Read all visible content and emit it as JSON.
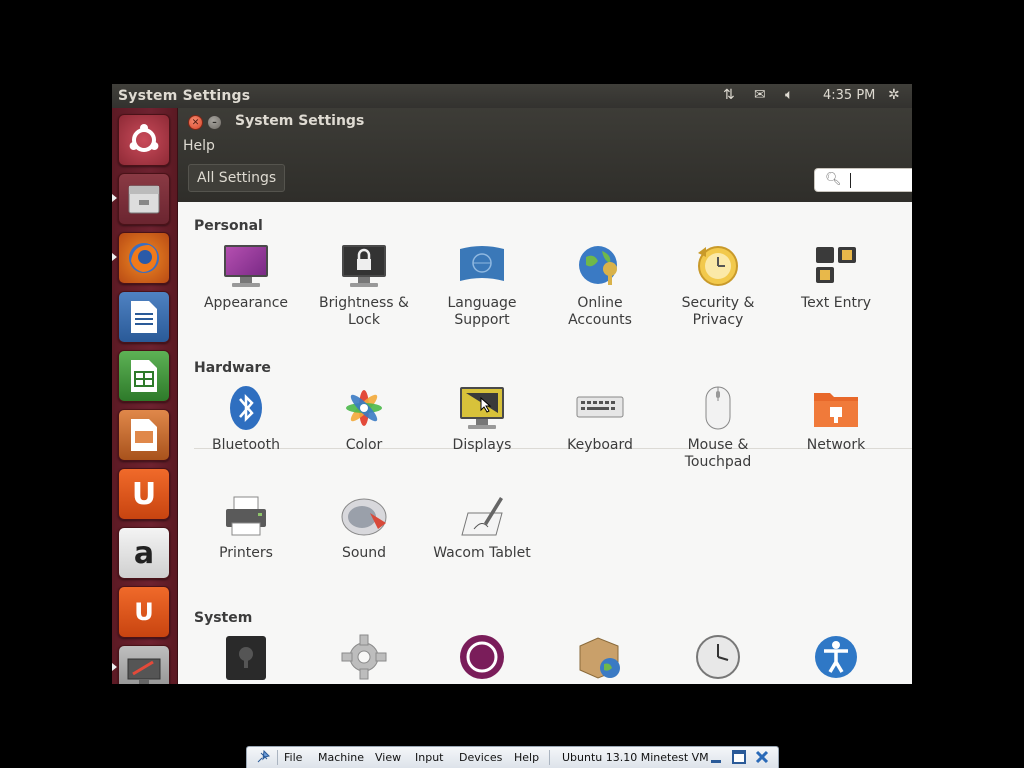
{
  "panel": {
    "title": "System Settings",
    "clock": "4:35 PM"
  },
  "window": {
    "title": "System Settings",
    "menu_help": "Help",
    "all_settings": "All Settings",
    "search_placeholder": ""
  },
  "sections": {
    "personal": {
      "title": "Personal",
      "items": [
        {
          "label1": "Appearance",
          "label2": ""
        },
        {
          "label1": "Brightness &",
          "label2": "Lock"
        },
        {
          "label1": "Language",
          "label2": "Support"
        },
        {
          "label1": "Online",
          "label2": "Accounts"
        },
        {
          "label1": "Security &",
          "label2": "Privacy"
        },
        {
          "label1": "Text Entry",
          "label2": ""
        }
      ]
    },
    "hardware": {
      "title": "Hardware",
      "items": [
        {
          "label1": "Bluetooth",
          "label2": ""
        },
        {
          "label1": "Color",
          "label2": ""
        },
        {
          "label1": "Displays",
          "label2": ""
        },
        {
          "label1": "Keyboard",
          "label2": ""
        },
        {
          "label1": "Mouse &",
          "label2": "Touchpad"
        },
        {
          "label1": "Network",
          "label2": ""
        },
        {
          "label1": "Printers",
          "label2": ""
        },
        {
          "label1": "Sound",
          "label2": ""
        },
        {
          "label1": "Wacom Tablet",
          "label2": ""
        }
      ]
    },
    "system": {
      "title": "System"
    }
  },
  "host_bar": {
    "menus": [
      "File",
      "Machine",
      "View",
      "Input",
      "Devices",
      "Help"
    ],
    "vm_name": "Ubuntu 13.10 Minetest VM"
  },
  "colors": {
    "launcher": "#6e2230",
    "accent_orange": "#dd4814",
    "close_button": "#d8472b"
  }
}
